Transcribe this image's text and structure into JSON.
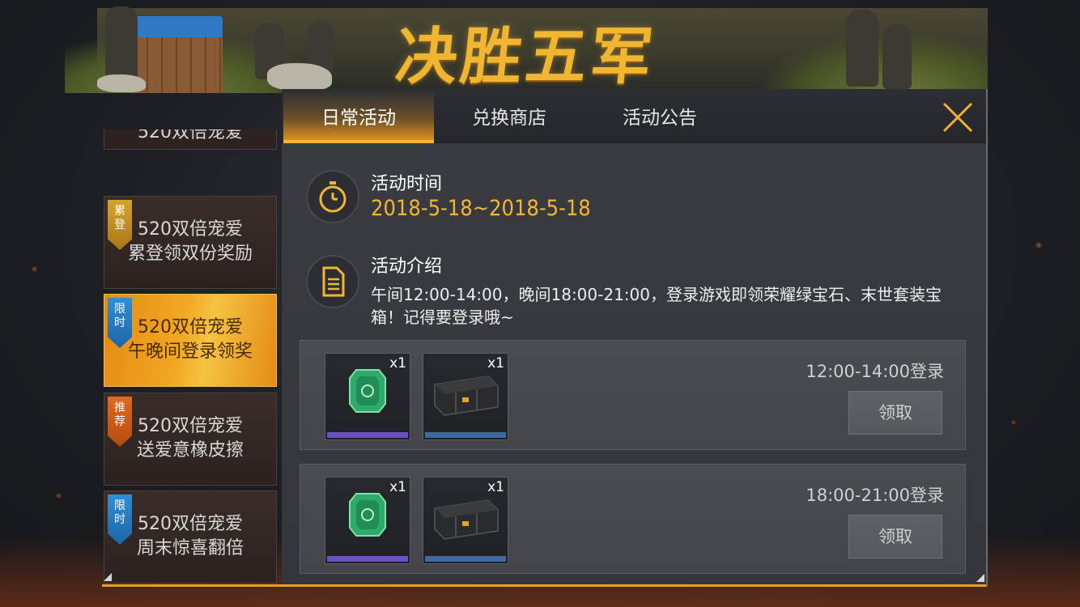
{
  "banner": {
    "title": "决胜五军"
  },
  "tabs": [
    {
      "label": "日常活动",
      "active": true
    },
    {
      "label": "兑换商店",
      "active": false
    },
    {
      "label": "活动公告",
      "active": false
    }
  ],
  "sidebar": {
    "items": [
      {
        "tag": "",
        "line1": "520双倍宠爱",
        "line2": "",
        "active": false
      },
      {
        "tag": "累登",
        "line1": "520双倍宠爱",
        "line2": "累登领双份奖励",
        "active": false
      },
      {
        "tag": "限时",
        "line1": "520双倍宠爱",
        "line2": "午晚间登录领奖",
        "active": true
      },
      {
        "tag": "推荐",
        "line1": "520双倍宠爱",
        "line2": "送爱意橡皮擦",
        "active": false
      },
      {
        "tag": "限时",
        "line1": "520双倍宠爱",
        "line2": "周末惊喜翻倍",
        "active": false
      }
    ]
  },
  "activity": {
    "time_label": "活动时间",
    "time_value": "2018-5-18~2018-5-18",
    "intro_label": "活动介绍",
    "intro_text": "午间12:00-14:00，晚间18:00-21:00，登录游戏即领荣耀绿宝石、末世套装宝箱！记得要登录哦~"
  },
  "rewards": [
    {
      "time": "12:00-14:00登录",
      "claim_label": "领取",
      "items": [
        {
          "icon": "green-gem-icon",
          "count": "x1",
          "rarity_color": "#6b4fc4"
        },
        {
          "icon": "black-crate-icon",
          "count": "x1",
          "rarity_color": "#3e6a9e"
        }
      ]
    },
    {
      "time": "18:00-21:00登录",
      "claim_label": "领取",
      "items": [
        {
          "icon": "green-gem-icon",
          "count": "x1",
          "rarity_color": "#6b4fc4"
        },
        {
          "icon": "black-crate-icon",
          "count": "x1",
          "rarity_color": "#3e6a9e"
        }
      ]
    }
  ],
  "colors": {
    "accent": "#f3b631",
    "active_tab": "#e8961e"
  }
}
